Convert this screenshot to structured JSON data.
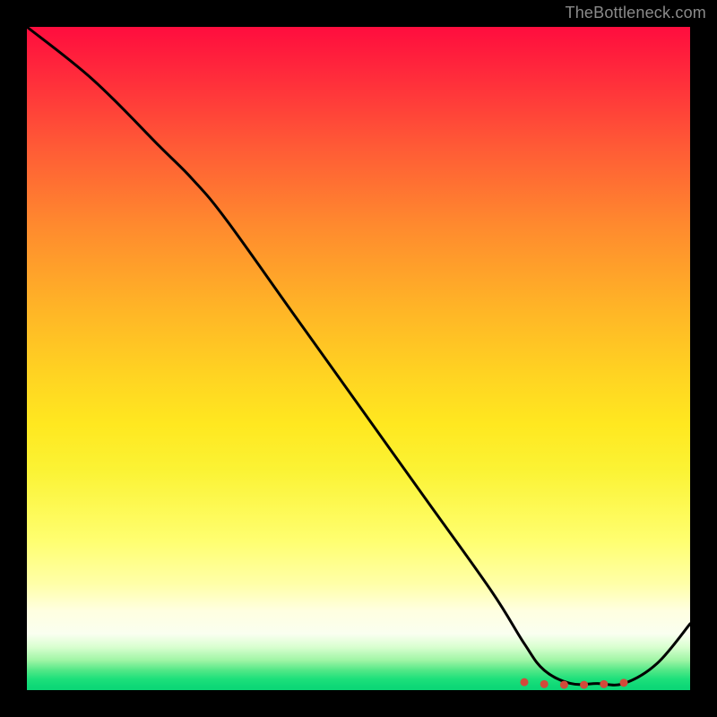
{
  "attribution": "TheBottleneck.com",
  "chart_data": {
    "type": "line",
    "title": "",
    "xlabel": "",
    "ylabel": "",
    "xlim": [
      0,
      100
    ],
    "ylim": [
      0,
      100
    ],
    "series": [
      {
        "name": "curve",
        "x": [
          0,
          10,
          20,
          25,
          30,
          40,
          50,
          60,
          70,
          75,
          78,
          82,
          86,
          90,
          95,
          100
        ],
        "y": [
          100,
          92,
          82,
          77,
          71,
          57,
          43,
          29,
          15,
          7,
          3,
          1,
          1,
          1,
          4,
          10
        ]
      }
    ],
    "markers": {
      "name": "optimum-band",
      "x": [
        75,
        78,
        81,
        84,
        87,
        90
      ],
      "y": [
        1.2,
        0.9,
        0.8,
        0.8,
        0.9,
        1.1
      ],
      "color": "#d24a3a",
      "radius": 4.5
    },
    "gradient_stops": [
      {
        "pos": 0.0,
        "color": "#ff0d3e"
      },
      {
        "pos": 0.3,
        "color": "#ff8a2e"
      },
      {
        "pos": 0.6,
        "color": "#ffe820"
      },
      {
        "pos": 0.88,
        "color": "#ffffe0"
      },
      {
        "pos": 1.0,
        "color": "#0cd676"
      }
    ]
  }
}
